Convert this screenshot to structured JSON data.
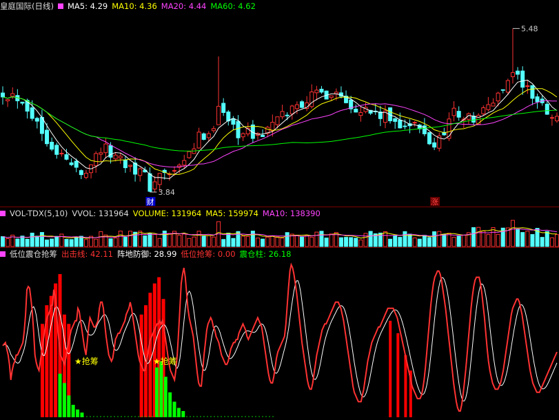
{
  "header_main": {
    "title": "皇庭国际(日线)",
    "ma5": "MA5: 4.29",
    "ma10": "MA10: 4.36",
    "ma20": "MA20: 4.44",
    "ma60": "MA60: 4.62"
  },
  "header_vol": {
    "title": "VOL-TDX(5,10)",
    "vvol": "VVOL: 131964",
    "volume": "VOLUME: 131964",
    "ma5": "MA5: 159974",
    "ma10": "MA10: 138390"
  },
  "header_ind": {
    "title": "低位震仓抢筹",
    "out": "出击线: 42.11",
    "defense": "阵地防御: 28.99",
    "grab": "低位抢筹: 0.00",
    "shake": "震仓柱: 26.18"
  },
  "colors": {
    "up": "#ff3232",
    "down": "#54ffff",
    "ma5": "#ffffff",
    "ma10": "#ffff00",
    "ma20": "#ff44ff",
    "ma60": "#00ff00",
    "shake_bar": "#00ff00",
    "grab_bar": "#ff0000",
    "signal": "#ffff00"
  },
  "chart_data": [
    {
      "type": "candlestick",
      "title": "皇庭国际(日线)",
      "ylim": [
        3.8,
        5.5
      ],
      "annotations": {
        "high": "5.48",
        "low": "3.84",
        "mark_low": "财",
        "mark_high": "涨"
      },
      "series_names": [
        "MA5",
        "MA10",
        "MA20",
        "MA60"
      ]
    },
    {
      "type": "bar",
      "title": "VOL-TDX(5,10)",
      "series_names": [
        "VOLUME",
        "MA5",
        "MA10"
      ]
    },
    {
      "type": "line",
      "title": "低位震仓抢筹",
      "ylim": [
        0,
        100
      ],
      "series_names": [
        "出击线",
        "阵地防御",
        "低位抢筹",
        "震仓柱"
      ],
      "signal_label": "★抢筹",
      "signal_label2": "★抢筹",
      "out": [
        46,
        47,
        48,
        44,
        40,
        34,
        24,
        30,
        34,
        36,
        40,
        40,
        42,
        44,
        46,
        48,
        55,
        66,
        82,
        84,
        83,
        76,
        68,
        55,
        40,
        35,
        32,
        30,
        36,
        42,
        48,
        54,
        60,
        64,
        66,
        68,
        72,
        72,
        82,
        78,
        68,
        56,
        48,
        40,
        38,
        36,
        34,
        38,
        44,
        48,
        52,
        56,
        58,
        60,
        62,
        62,
        70,
        68,
        62,
        56,
        50,
        44,
        40,
        48,
        58,
        64,
        62,
        60,
        58,
        58,
        60,
        62,
        70,
        74,
        74,
        70,
        60,
        52,
        46,
        40,
        38,
        36,
        38,
        44,
        50,
        52,
        54,
        54,
        56,
        58,
        60,
        62,
        66,
        68,
        70,
        74,
        70,
        64,
        58,
        52,
        46,
        40,
        36,
        34,
        32,
        30,
        30,
        34,
        40,
        46,
        50,
        52,
        54,
        56,
        58,
        60,
        60,
        62,
        60,
        62,
        58,
        52,
        46,
        40,
        34,
        30,
        28,
        26,
        24,
        30,
        40,
        54,
        70,
        86,
        92,
        96,
        90,
        80,
        70,
        64,
        60,
        56,
        52,
        44,
        36,
        28,
        22,
        20,
        20,
        30,
        40,
        48,
        56,
        60,
        62,
        64,
        62,
        58,
        56,
        52,
        50,
        48,
        44,
        40,
        38,
        36,
        34,
        34,
        36,
        40,
        44,
        46,
        48,
        48,
        50,
        50,
        54,
        56,
        58,
        60,
        58,
        56,
        52,
        50,
        52,
        54,
        56,
        58,
        60,
        62,
        64,
        62,
        60,
        58,
        52,
        46,
        40,
        34,
        28,
        24,
        22,
        22,
        26,
        32,
        38,
        42,
        44,
        46,
        48,
        50,
        52,
        60,
        72,
        84,
        94,
        98,
        96,
        92,
        86,
        80,
        72,
        64,
        56,
        48,
        42,
        36,
        30,
        24,
        20,
        18,
        18,
        22,
        28,
        34,
        40,
        44,
        48,
        52,
        56,
        58,
        60,
        60,
        62,
        64,
        66,
        68,
        70,
        72,
        74,
        74,
        74,
        72,
        70,
        66,
        62,
        56,
        50,
        44,
        38,
        32,
        26,
        20,
        16,
        14,
        12,
        10,
        10,
        10,
        14,
        18,
        24,
        30,
        36,
        40,
        44,
        48,
        50,
        52,
        54,
        56,
        58,
        58,
        60,
        62,
        64,
        66,
        68,
        70,
        70,
        70,
        70,
        70,
        68,
        66,
        64,
        60,
        56,
        52,
        48,
        44,
        40,
        36,
        32,
        28,
        24,
        20,
        18,
        16,
        14,
        12,
        12,
        12,
        14,
        18,
        24,
        32,
        42,
        52,
        62,
        72,
        80,
        86,
        90,
        92,
        94,
        94,
        92,
        88,
        82,
        76,
        70,
        62,
        54,
        46,
        38,
        30,
        22,
        16,
        10,
        6,
        4,
        4,
        8,
        14,
        22,
        30,
        40,
        50,
        60,
        70,
        78,
        84,
        88,
        90,
        90,
        90,
        86,
        80,
        72,
        64,
        54,
        44,
        36,
        30,
        26,
        22,
        20,
        18,
        18,
        18,
        20,
        22,
        26,
        30,
        36,
        42,
        48,
        54,
        60,
        66,
        70,
        72,
        74,
        76,
        76,
        74,
        70,
        66,
        60,
        54,
        48,
        42,
        36,
        30,
        26,
        22,
        20,
        18,
        16,
        16,
        16,
        18,
        20,
        22,
        24,
        26,
        28,
        30,
        32,
        34,
        36,
        38,
        40,
        42
      ]
    }
  ]
}
